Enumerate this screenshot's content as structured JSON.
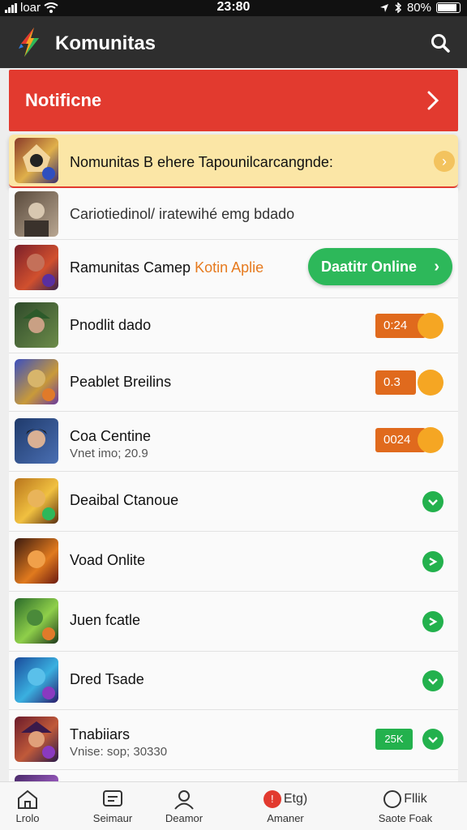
{
  "status_bar": {
    "carrier": "loar",
    "time": "23:80",
    "battery_percent": "80%"
  },
  "app_bar": {
    "title": "Komunitas"
  },
  "notification": {
    "label": "Notificne"
  },
  "rows": [
    {
      "name": "Nomunitas B ehere  Tapounilcarcangnde:",
      "trail": "›"
    },
    {
      "name": "Cariotiedinol/ iratewihé emg bdado"
    },
    {
      "name": "Ramunitas Camep",
      "highlight": "Kotin Aplie",
      "pill": "Daatitr Online"
    },
    {
      "name": "Pnodlit dado",
      "score": "0:24"
    },
    {
      "name": "Peablet Breilins",
      "score": "0.3"
    },
    {
      "name": "Coa Centine",
      "sub": "Vnet imo; 20.9",
      "score": "0024"
    },
    {
      "name": "Deaibal Ctanoue"
    },
    {
      "name": "Voad Onlite"
    },
    {
      "name": "Juen fcatle"
    },
    {
      "name": "Dred Tsade"
    },
    {
      "name": "Tnabiiars",
      "sub": "Vnise: sop; 30330",
      "badge": "25K"
    }
  ],
  "bottom_nav": [
    {
      "label": "Lrolo"
    },
    {
      "label": "Seimaur"
    },
    {
      "label": "Deamor"
    },
    {
      "label": "Amaner",
      "top": "Etg)"
    },
    {
      "label": "Saote Foak",
      "top": "Fllik"
    }
  ],
  "colors": {
    "accent_red": "#e23a2f",
    "online_green": "#2db85a",
    "score_orange": "#e06a1d",
    "score_dot": "#f5a623",
    "appbar": "#2e2e2e"
  }
}
